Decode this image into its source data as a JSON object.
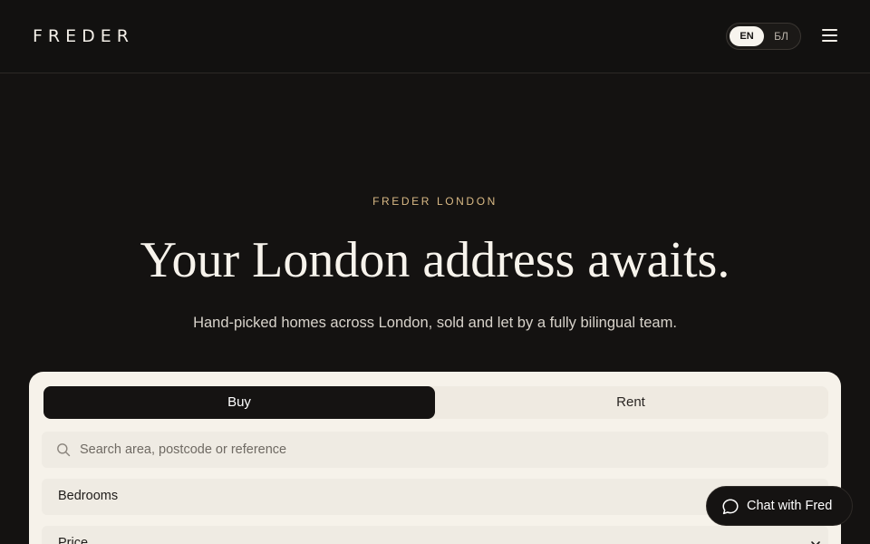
{
  "header": {
    "logo": "FREDER",
    "language": {
      "active": "EN",
      "inactive": "БЛ"
    },
    "menu_icon": "hamburger-menu-icon"
  },
  "hero": {
    "eyebrow": "FREDER LONDON",
    "title": "Your London address awaits.",
    "subtitle": "Hand-picked homes across London, sold and let by a fully bilingual team."
  },
  "search": {
    "tabs": [
      {
        "label": "Buy",
        "active": true
      },
      {
        "label": "Rent",
        "active": false
      }
    ],
    "placeholder": "Search area, postcode or reference",
    "search_icon": "search-icon",
    "filters": [
      {
        "label": "Bedrooms"
      },
      {
        "label": "Price"
      }
    ]
  },
  "chat": {
    "label": "Chat with Fred",
    "icon": "chat-bubble-icon"
  },
  "colors": {
    "background": "#141211",
    "accent": "#d9b985",
    "card": "#f6f2ea",
    "dark": "#151312"
  }
}
